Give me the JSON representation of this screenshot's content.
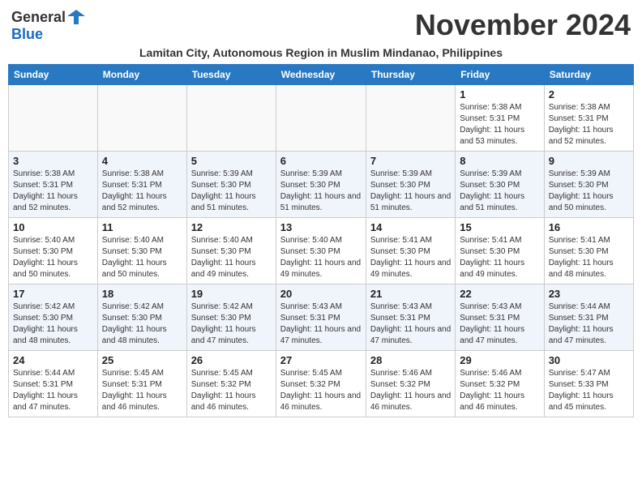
{
  "header": {
    "logo_general": "General",
    "logo_blue": "Blue",
    "month_title": "November 2024",
    "subtitle": "Lamitan City, Autonomous Region in Muslim Mindanao, Philippines"
  },
  "days_of_week": [
    "Sunday",
    "Monday",
    "Tuesday",
    "Wednesday",
    "Thursday",
    "Friday",
    "Saturday"
  ],
  "weeks": [
    [
      {
        "day": "",
        "empty": true
      },
      {
        "day": "",
        "empty": true
      },
      {
        "day": "",
        "empty": true
      },
      {
        "day": "",
        "empty": true
      },
      {
        "day": "",
        "empty": true
      },
      {
        "day": "1",
        "sunrise": "5:38 AM",
        "sunset": "5:31 PM",
        "daylight": "11 hours and 53 minutes."
      },
      {
        "day": "2",
        "sunrise": "5:38 AM",
        "sunset": "5:31 PM",
        "daylight": "11 hours and 52 minutes."
      }
    ],
    [
      {
        "day": "3",
        "sunrise": "5:38 AM",
        "sunset": "5:31 PM",
        "daylight": "11 hours and 52 minutes."
      },
      {
        "day": "4",
        "sunrise": "5:38 AM",
        "sunset": "5:31 PM",
        "daylight": "11 hours and 52 minutes."
      },
      {
        "day": "5",
        "sunrise": "5:39 AM",
        "sunset": "5:30 PM",
        "daylight": "11 hours and 51 minutes."
      },
      {
        "day": "6",
        "sunrise": "5:39 AM",
        "sunset": "5:30 PM",
        "daylight": "11 hours and 51 minutes."
      },
      {
        "day": "7",
        "sunrise": "5:39 AM",
        "sunset": "5:30 PM",
        "daylight": "11 hours and 51 minutes."
      },
      {
        "day": "8",
        "sunrise": "5:39 AM",
        "sunset": "5:30 PM",
        "daylight": "11 hours and 51 minutes."
      },
      {
        "day": "9",
        "sunrise": "5:39 AM",
        "sunset": "5:30 PM",
        "daylight": "11 hours and 50 minutes."
      }
    ],
    [
      {
        "day": "10",
        "sunrise": "5:40 AM",
        "sunset": "5:30 PM",
        "daylight": "11 hours and 50 minutes."
      },
      {
        "day": "11",
        "sunrise": "5:40 AM",
        "sunset": "5:30 PM",
        "daylight": "11 hours and 50 minutes."
      },
      {
        "day": "12",
        "sunrise": "5:40 AM",
        "sunset": "5:30 PM",
        "daylight": "11 hours and 49 minutes."
      },
      {
        "day": "13",
        "sunrise": "5:40 AM",
        "sunset": "5:30 PM",
        "daylight": "11 hours and 49 minutes."
      },
      {
        "day": "14",
        "sunrise": "5:41 AM",
        "sunset": "5:30 PM",
        "daylight": "11 hours and 49 minutes."
      },
      {
        "day": "15",
        "sunrise": "5:41 AM",
        "sunset": "5:30 PM",
        "daylight": "11 hours and 49 minutes."
      },
      {
        "day": "16",
        "sunrise": "5:41 AM",
        "sunset": "5:30 PM",
        "daylight": "11 hours and 48 minutes."
      }
    ],
    [
      {
        "day": "17",
        "sunrise": "5:42 AM",
        "sunset": "5:30 PM",
        "daylight": "11 hours and 48 minutes."
      },
      {
        "day": "18",
        "sunrise": "5:42 AM",
        "sunset": "5:30 PM",
        "daylight": "11 hours and 48 minutes."
      },
      {
        "day": "19",
        "sunrise": "5:42 AM",
        "sunset": "5:30 PM",
        "daylight": "11 hours and 47 minutes."
      },
      {
        "day": "20",
        "sunrise": "5:43 AM",
        "sunset": "5:31 PM",
        "daylight": "11 hours and 47 minutes."
      },
      {
        "day": "21",
        "sunrise": "5:43 AM",
        "sunset": "5:31 PM",
        "daylight": "11 hours and 47 minutes."
      },
      {
        "day": "22",
        "sunrise": "5:43 AM",
        "sunset": "5:31 PM",
        "daylight": "11 hours and 47 minutes."
      },
      {
        "day": "23",
        "sunrise": "5:44 AM",
        "sunset": "5:31 PM",
        "daylight": "11 hours and 47 minutes."
      }
    ],
    [
      {
        "day": "24",
        "sunrise": "5:44 AM",
        "sunset": "5:31 PM",
        "daylight": "11 hours and 47 minutes."
      },
      {
        "day": "25",
        "sunrise": "5:45 AM",
        "sunset": "5:31 PM",
        "daylight": "11 hours and 46 minutes."
      },
      {
        "day": "26",
        "sunrise": "5:45 AM",
        "sunset": "5:32 PM",
        "daylight": "11 hours and 46 minutes."
      },
      {
        "day": "27",
        "sunrise": "5:45 AM",
        "sunset": "5:32 PM",
        "daylight": "11 hours and 46 minutes."
      },
      {
        "day": "28",
        "sunrise": "5:46 AM",
        "sunset": "5:32 PM",
        "daylight": "11 hours and 46 minutes."
      },
      {
        "day": "29",
        "sunrise": "5:46 AM",
        "sunset": "5:32 PM",
        "daylight": "11 hours and 46 minutes."
      },
      {
        "day": "30",
        "sunrise": "5:47 AM",
        "sunset": "5:33 PM",
        "daylight": "11 hours and 45 minutes."
      }
    ]
  ]
}
